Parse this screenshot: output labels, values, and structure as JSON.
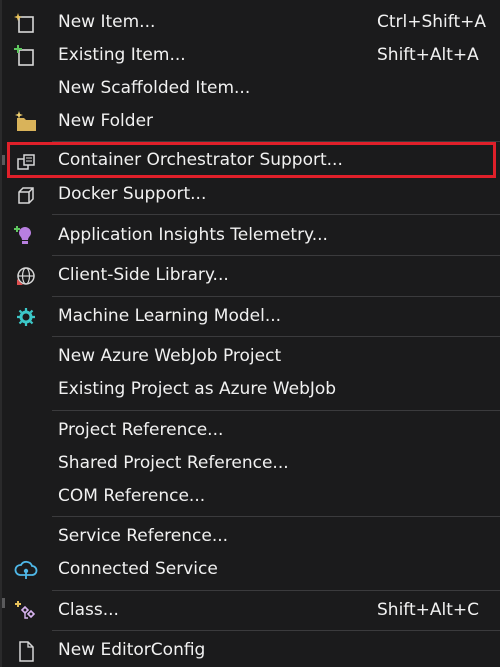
{
  "menu": {
    "items": [
      {
        "label": "New Item...",
        "shortcut": "Ctrl+Shift+A",
        "icon": "new-item-icon"
      },
      {
        "label": "Existing Item...",
        "shortcut": "Shift+Alt+A",
        "icon": "existing-item-icon"
      },
      {
        "label": "New Scaffolded Item...",
        "shortcut": "",
        "icon": ""
      },
      {
        "label": "New Folder",
        "shortcut": "",
        "icon": "new-folder-icon"
      },
      {
        "label": "Container Orchestrator Support...",
        "shortcut": "",
        "icon": "container-orchestrator-icon"
      },
      {
        "label": "Docker Support...",
        "shortcut": "",
        "icon": "docker-icon"
      },
      {
        "label": "Application Insights Telemetry...",
        "shortcut": "",
        "icon": "app-insights-icon"
      },
      {
        "label": "Client-Side Library...",
        "shortcut": "",
        "icon": "client-library-icon"
      },
      {
        "label": "Machine Learning Model...",
        "shortcut": "",
        "icon": "machine-learning-icon"
      },
      {
        "label": "New Azure WebJob Project",
        "shortcut": "",
        "icon": ""
      },
      {
        "label": "Existing Project as Azure WebJob",
        "shortcut": "",
        "icon": ""
      },
      {
        "label": "Project Reference...",
        "shortcut": "",
        "icon": ""
      },
      {
        "label": "Shared Project Reference...",
        "shortcut": "",
        "icon": ""
      },
      {
        "label": "COM Reference...",
        "shortcut": "",
        "icon": ""
      },
      {
        "label": "Service Reference...",
        "shortcut": "",
        "icon": ""
      },
      {
        "label": "Connected Service",
        "shortcut": "",
        "icon": "connected-service-icon"
      },
      {
        "label": "Class...",
        "shortcut": "Shift+Alt+C",
        "icon": "class-icon"
      },
      {
        "label": "New EditorConfig",
        "shortcut": "",
        "icon": "editorconfig-icon"
      }
    ]
  },
  "colors": {
    "background": "#1b1b1c",
    "text": "#f1f1f1",
    "separator": "#3b3b3d",
    "highlight_border": "#e0202a"
  }
}
